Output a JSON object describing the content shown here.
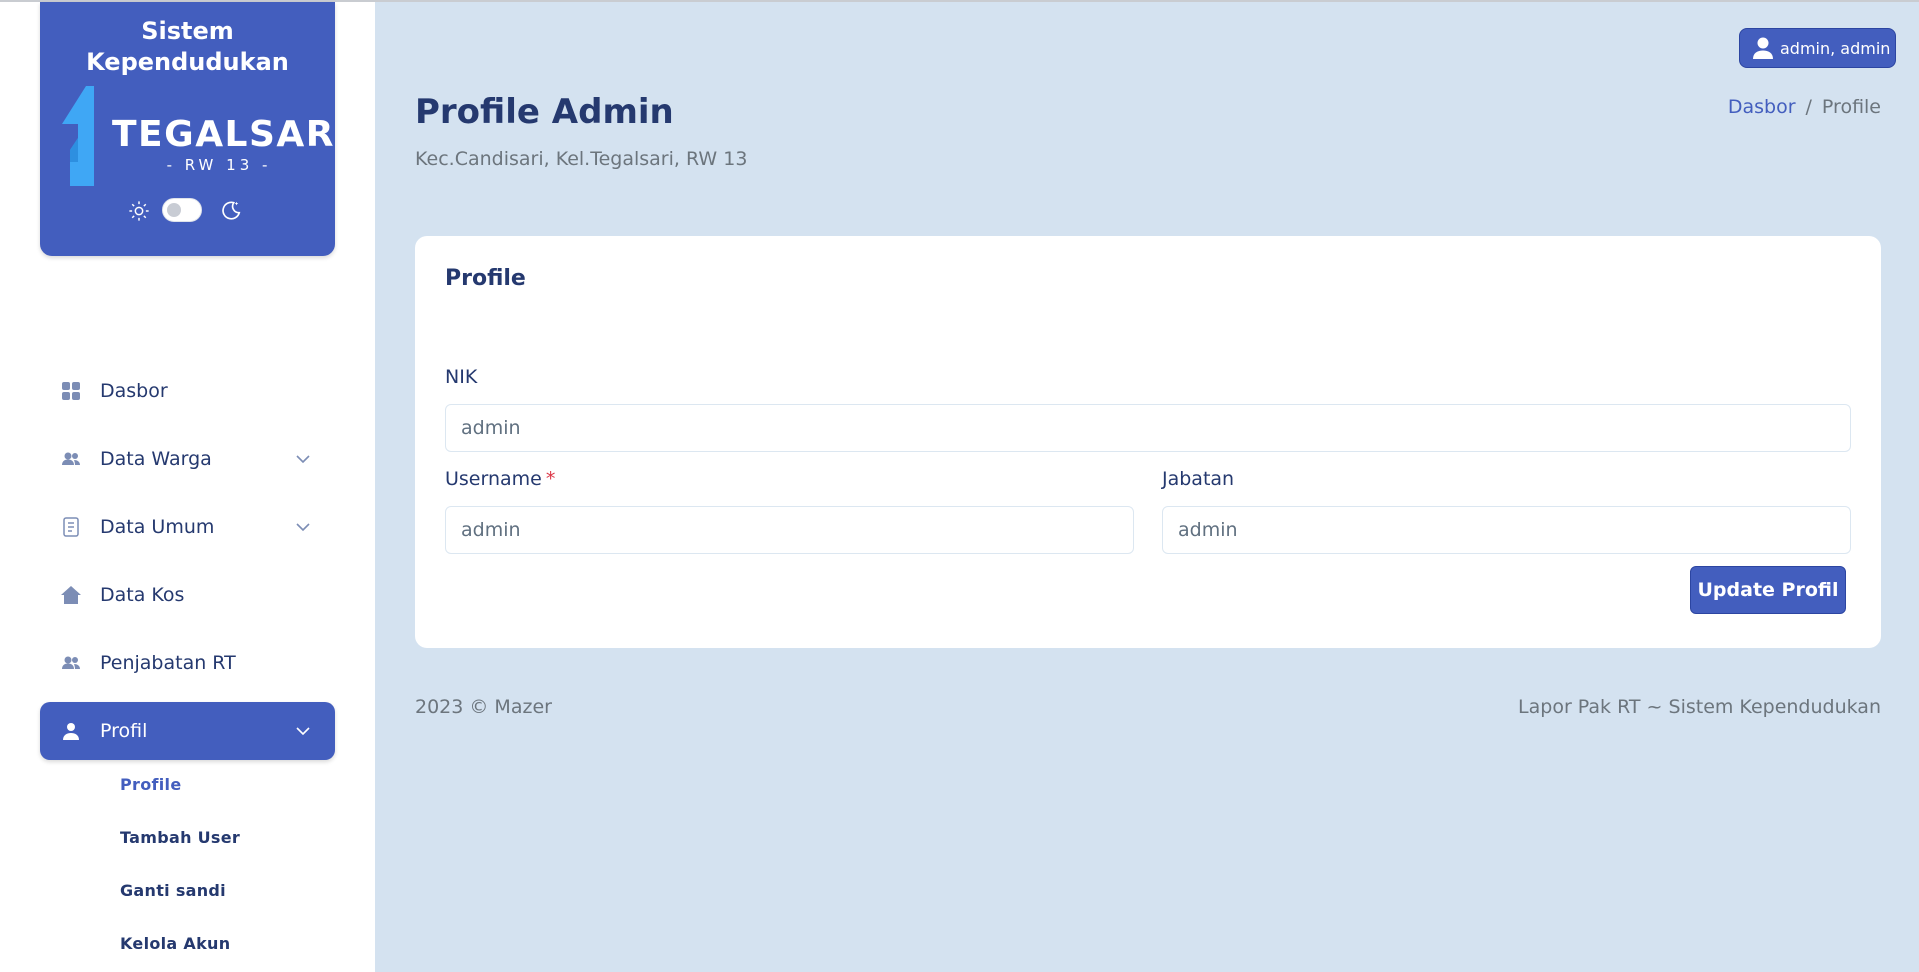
{
  "brand": {
    "title_line1": "Sistem",
    "title_line2": "Kependudukan",
    "logo_text": "TEGALSARI",
    "logo_sub": "- RW 13 -",
    "accent": "#435ebe",
    "logo_arrow_color": "#3fa7f5"
  },
  "theme_toggle": {
    "light_icon": "sun-icon",
    "dark_icon": "moon-icon",
    "state": "light"
  },
  "sidebar": {
    "items": [
      {
        "label": "Dasbor",
        "icon": "grid-icon",
        "has_submenu": false
      },
      {
        "label": "Data Warga",
        "icon": "people-icon",
        "has_submenu": true
      },
      {
        "label": "Data Umum",
        "icon": "document-icon",
        "has_submenu": true
      },
      {
        "label": "Data Kos",
        "icon": "house-icon",
        "has_submenu": false
      },
      {
        "label": "Penjabatan RT",
        "icon": "people-icon",
        "has_submenu": false
      },
      {
        "label": "Profil",
        "icon": "person-icon",
        "has_submenu": true,
        "active": true
      }
    ],
    "submenu": [
      {
        "label": "Profile",
        "active": true
      },
      {
        "label": "Tambah User"
      },
      {
        "label": "Ganti sandi"
      },
      {
        "label": "Kelola Akun"
      }
    ]
  },
  "header": {
    "user_label": "admin, admin"
  },
  "page": {
    "title": "Profile Admin",
    "subtitle": "Kec.Candisari, Kel.Tegalsari, RW 13",
    "breadcrumb": [
      "Dasbor",
      "Profile"
    ],
    "breadcrumb_sep": "/"
  },
  "card": {
    "title": "Profile",
    "fields": {
      "nik": {
        "label": "NIK",
        "value": "admin"
      },
      "username": {
        "label": "Username",
        "required_mark": "*",
        "value": "admin"
      },
      "jabatan": {
        "label": "Jabatan",
        "value": "admin"
      }
    },
    "submit_label": "Update Profil"
  },
  "footer": {
    "left": "2023 © Mazer",
    "right": "Lapor Pak RT ~ Sistem Kependudukan"
  }
}
